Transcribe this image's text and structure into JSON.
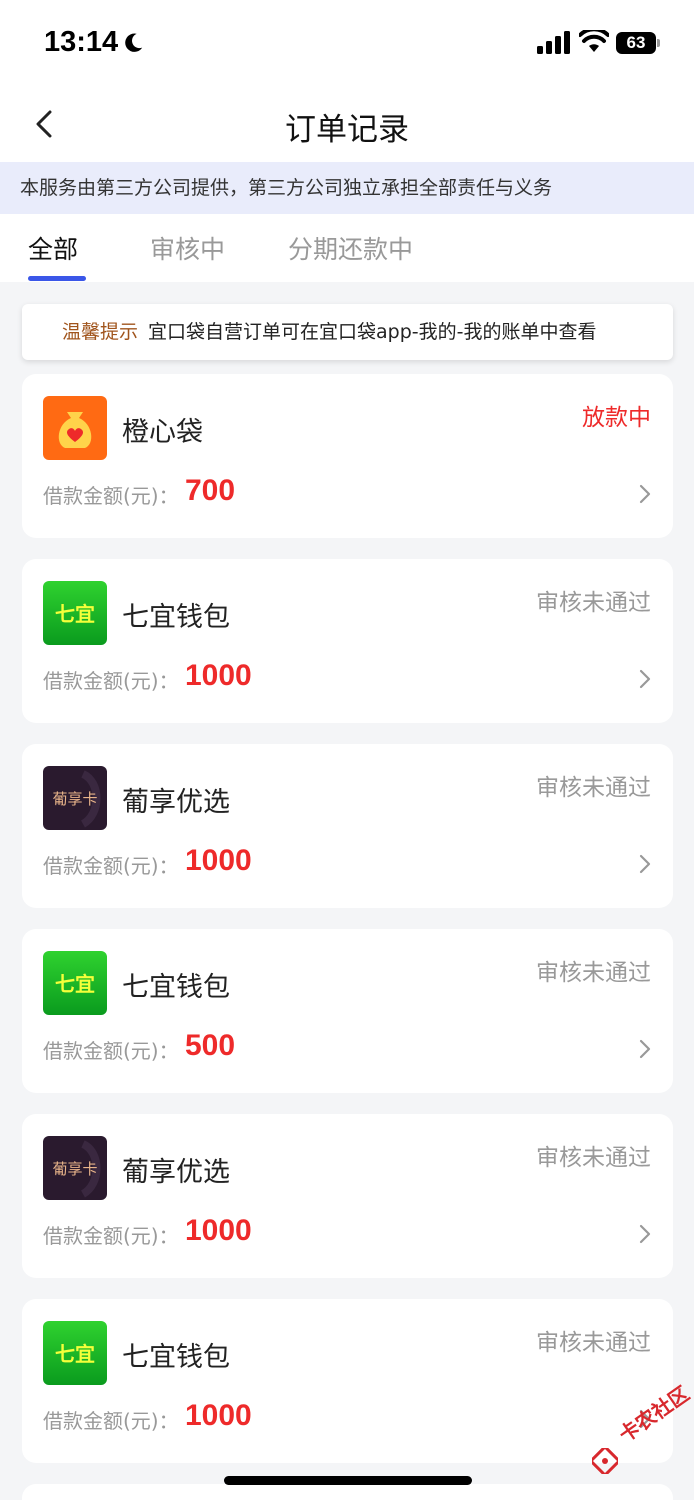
{
  "status_bar": {
    "time": "13:14",
    "battery": "63"
  },
  "nav": {
    "title": "订单记录"
  },
  "notice": {
    "text": "本服务由第三方公司提供，第三方公司独立承担全部责任与义务"
  },
  "tabs": [
    {
      "label": "全部",
      "active": true
    },
    {
      "label": "审核中",
      "active": false
    },
    {
      "label": "分期还款中",
      "active": false
    }
  ],
  "tip": {
    "label": "温馨提示",
    "text": "宜口袋自营订单可在宜口袋app-我的-我的账单中查看"
  },
  "amount_label": "借款金额(元)：",
  "orders": [
    {
      "name": "橙心袋",
      "status": "放款中",
      "amount": "700",
      "logo": "orange-heart-bag-icon"
    },
    {
      "name": "七宜钱包",
      "status": "审核未通过",
      "amount": "1000",
      "logo": "qiyi-wallet-logo",
      "logo_text": "七宜"
    },
    {
      "name": "葡享优选",
      "status": "审核未通过",
      "amount": "1000",
      "logo": "puxiang-card-logo",
      "logo_text": "葡享卡"
    },
    {
      "name": "七宜钱包",
      "status": "审核未通过",
      "amount": "500",
      "logo": "qiyi-wallet-logo",
      "logo_text": "七宜"
    },
    {
      "name": "葡享优选",
      "status": "审核未通过",
      "amount": "1000",
      "logo": "puxiang-card-logo",
      "logo_text": "葡享卡"
    },
    {
      "name": "七宜钱包",
      "status": "审核未通过",
      "amount": "1000",
      "logo": "qiyi-wallet-logo",
      "logo_text": "七宜"
    }
  ],
  "watermark": {
    "text": "卡农社区"
  },
  "colors": {
    "accent": "#3a56e8",
    "amount_red": "#ee2a2a",
    "tip_label": "#a0541c",
    "notice_bg": "#e9ecfb"
  }
}
